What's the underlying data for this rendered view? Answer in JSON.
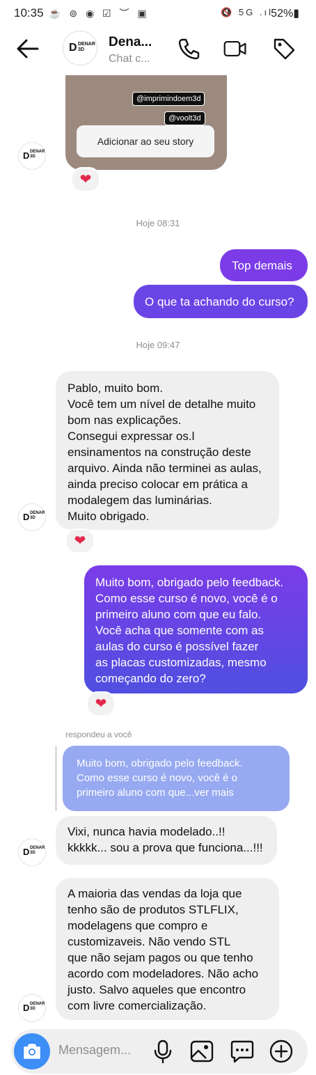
{
  "status_bar": {
    "time": "10:35",
    "left_icons": "☕ ⊚ ◉ ☑ ︶ ▣",
    "right_icons": "🔇 5G .ıl",
    "battery": "52%▮"
  },
  "header": {
    "title": "Dena...",
    "subtitle": "Chat c...",
    "back_icon": "arrow-left-icon",
    "call_icon": "phone-icon",
    "video_icon": "video-icon",
    "tag_icon": "tag-icon"
  },
  "logo": {
    "initial": "D",
    "text_line1": "DENAR",
    "text_line2": "3D"
  },
  "story": {
    "tags": [
      "@imprimindoem3d",
      "@voolt3d"
    ],
    "button_label": "Adicionar ao seu story"
  },
  "reaction": "❤",
  "timestamps": [
    "Hoje 08:31",
    "Hoje 09:47"
  ],
  "messages": {
    "out1": "Top demais",
    "out2": "O que ta achando do curso?",
    "in1": "Pablo, muito bom.\nVocê tem um nível de detalhe muito\nbom nas explicações.\nConsegui expressar os.l\nensinamentos na construção deste\narquivo. Ainda não terminei as aulas,\nainda preciso colocar em prática a\nmodalegem das luminárias.\nMuito obrigado.",
    "out3": "Muito bom, obrigado pelo feedback.\nComo esse curso é novo, você é o\nprimeiro aluno com que eu falo.\nVocê acha que somente com as\naulas do curso é possível fazer\nas placas customizadas, mesmo\ncomeçando do zero?",
    "replied_label": "respondeu a você",
    "quote": "Muito bom, obrigado pelo feedback.\nComo esse curso é novo, você é o\nprimeiro aluno com que...ver mais",
    "in2": "Vixi, nunca havia modelado..!!\nkkkkk... sou a prova que funciona...!!!",
    "in3": "A maioria das vendas da loja que\ntenho são de produtos STLFLIX,\nmodelagens que compro e\ncustomizaveis. Não vendo STL\nque não sejam pagos ou que tenho\nacordo com modeladores. Não acho\njusto. Salvo aqueles que encontro\ncom livre comercialização."
  },
  "composer": {
    "placeholder": "Mensagem...",
    "camera_icon": "camera-icon",
    "mic_icon": "microphone-icon",
    "gallery_icon": "image-icon",
    "sticker_icon": "chat-sticker-icon",
    "add_icon": "plus-circle-icon"
  },
  "colors": {
    "outgoing_top": "#7b3ce8",
    "outgoing_bottom": "#4f4fe0",
    "incoming": "#efefef",
    "heart": "#e3284d",
    "camera": "#3d8ef6"
  }
}
